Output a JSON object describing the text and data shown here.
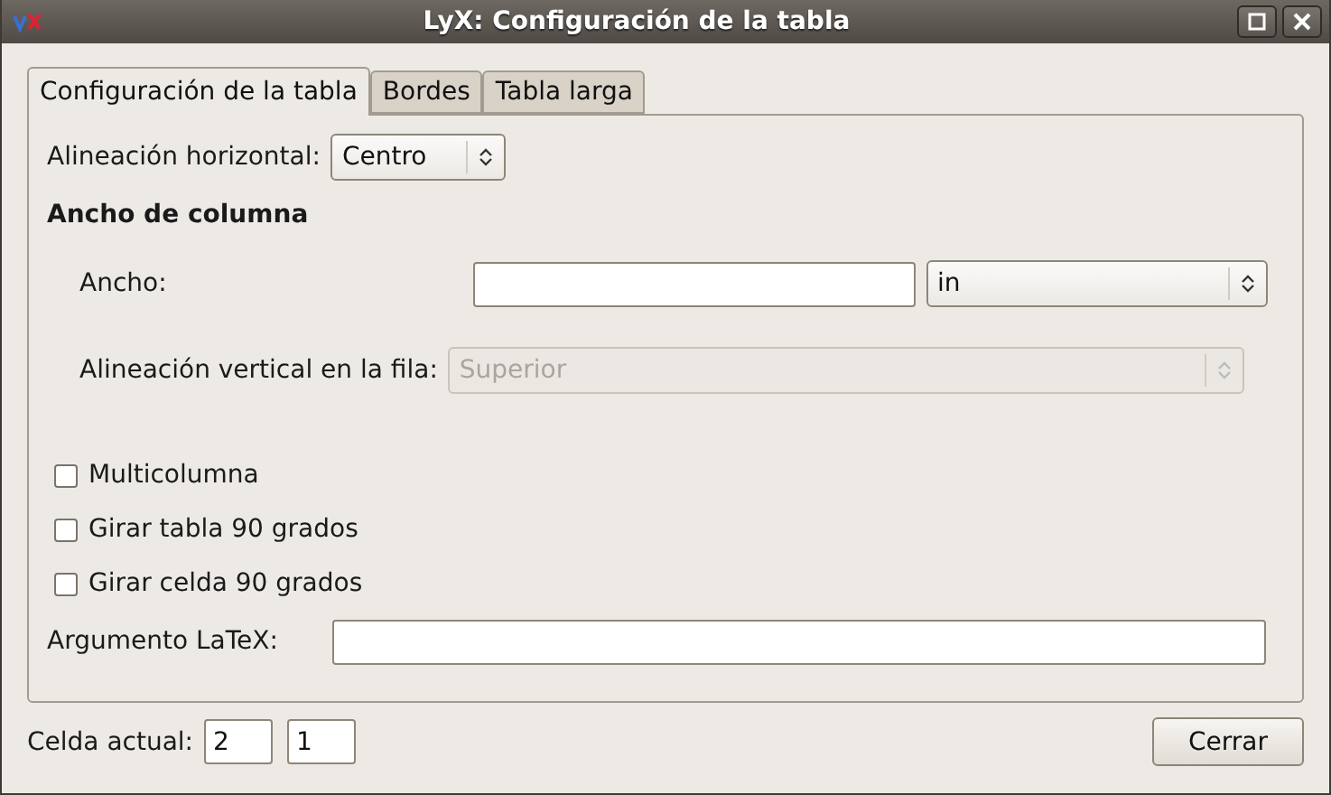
{
  "window": {
    "title": "LyX: Configuración de la tabla"
  },
  "tabs": [
    {
      "label": "Configuración de la tabla",
      "selected": true
    },
    {
      "label": "Bordes",
      "selected": false
    },
    {
      "label": "Tabla larga",
      "selected": false
    }
  ],
  "horizontal_alignment": {
    "label": "Alineación horizontal:",
    "value": "Centro"
  },
  "column_width": {
    "heading": "Ancho de columna",
    "width_label": "Ancho:",
    "unit": "in",
    "vertical_label": "Alineación vertical en la fila:",
    "vertical_value": "Superior",
    "vertical_disabled": true
  },
  "checkboxes": [
    {
      "label": "Multicolumna",
      "checked": false
    },
    {
      "label": "Girar tabla 90 grados",
      "checked": false
    },
    {
      "label": "Girar celda 90 grados",
      "checked": false
    }
  ],
  "latex_argument": {
    "label": "Argumento LaTeX:"
  },
  "current_cell": {
    "label": "Celda actual:",
    "row": "2",
    "column": "1"
  },
  "close_button": "Cerrar"
}
